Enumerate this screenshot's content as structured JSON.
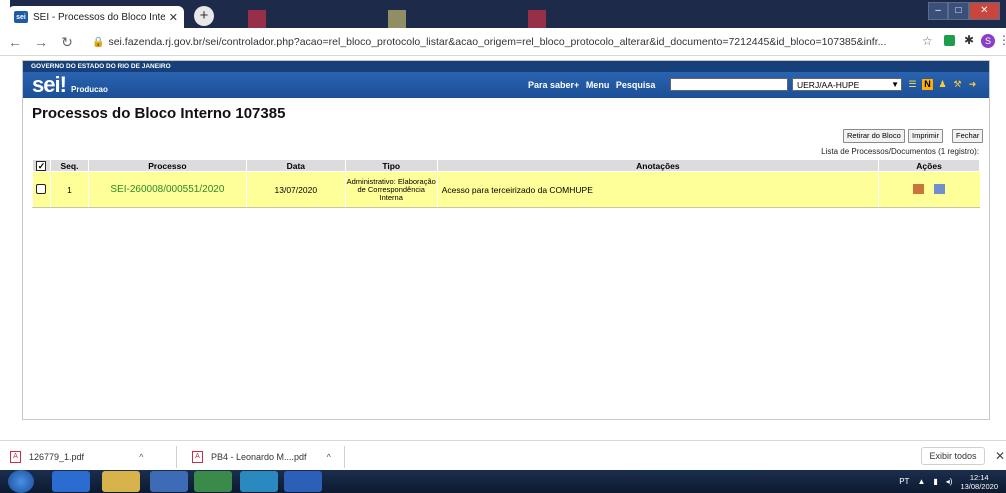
{
  "browser": {
    "tab_title": "SEI - Processos do Bloco Interno",
    "tab_close": "✕",
    "new_tab": "+",
    "favicon_text": "sei",
    "url": "sei.fazenda.rj.gov.br/sei/controlador.php?acao=rel_bloco_protocolo_listar&acao_origem=rel_bloco_protocolo_alterar&id_documento=7212445&id_bloco=107385&infr...",
    "profile_initial": "S"
  },
  "sei": {
    "gov_title": "GOVERNO DO ESTADO DO RIO DE JANEIRO",
    "logo": "sei!",
    "env": "Producao",
    "links": [
      "Para saber+",
      "Menu",
      "Pesquisa"
    ],
    "unit_selected": "UERJ/AA-HUPE"
  },
  "page": {
    "title": "Processos do Bloco Interno 107385",
    "buttons": {
      "retirar": "Retirar do Bloco",
      "imprimir": "Imprimir",
      "fechar": "Fechar"
    },
    "list_caption": "Lista de Processos/Documentos (1 registro):"
  },
  "table": {
    "headers": [
      "Seq.",
      "Processo",
      "Data",
      "Tipo",
      "Anotações",
      "Ações"
    ],
    "rows": [
      {
        "seq": "1",
        "processo": "SEI-260008/000551/2020",
        "data": "13/07/2020",
        "tipo": "Administrativo: Elaboração de Correspondência Interna",
        "anotacoes": "Acesso para terceirizado da COMHUPE"
      }
    ]
  },
  "downloads": {
    "items": [
      "126779_1.pdf",
      "PB4 - Leonardo M....pdf"
    ],
    "show_all": "Exibir todos",
    "close": "✕"
  },
  "taskbar": {
    "lang": "PT",
    "time": "12:14",
    "date": "13/08/2020"
  },
  "colors": {
    "sei_blue": "#1c4f97",
    "row_yellow": "#ffff99",
    "link_green": "#2d8a2d"
  }
}
